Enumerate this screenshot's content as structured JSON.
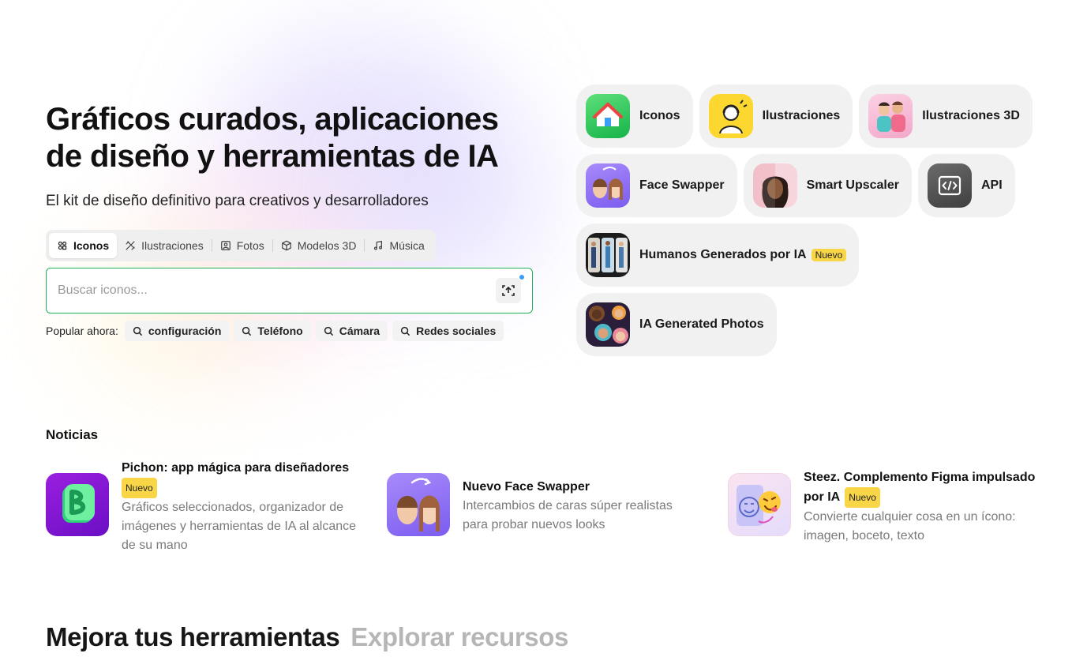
{
  "hero": {
    "title_line1": "Gráficos curados, aplicaciones",
    "title_line2": "de diseño y herramientas de IA",
    "subtitle": "El kit de diseño definitivo para creativos y desarrolladores"
  },
  "type_tabs": [
    {
      "label": "Iconos",
      "icon": "icons-icon",
      "active": true
    },
    {
      "label": "Ilustraciones",
      "icon": "illustrations-icon",
      "active": false
    },
    {
      "label": "Fotos",
      "icon": "photo-icon",
      "active": false
    },
    {
      "label": "Modelos 3D",
      "icon": "cube-icon",
      "active": false
    },
    {
      "label": "Música",
      "icon": "music-icon",
      "active": false
    }
  ],
  "search": {
    "placeholder": "Buscar iconos...",
    "value": "",
    "focus_color": "#20b15a"
  },
  "popular": {
    "label": "Popular ahora:",
    "items": [
      "configuración",
      "Teléfono",
      "Cámara",
      "Redes sociales"
    ]
  },
  "apps": [
    {
      "label": "Iconos",
      "icon": "house-app-icon"
    },
    {
      "label": "Ilustraciones",
      "icon": "illustration-app-icon"
    },
    {
      "label": "Ilustraciones 3D",
      "icon": "3d-illustration-app-icon"
    },
    {
      "label": "Face Swapper",
      "icon": "face-swapper-app-icon"
    },
    {
      "label": "Smart Upscaler",
      "icon": "upscaler-app-icon"
    },
    {
      "label": "API",
      "icon": "api-app-icon"
    },
    {
      "label": "Humanos Generados por IA",
      "icon": "humans-app-icon",
      "badge": "Nuevo"
    },
    {
      "label": "IA Generated Photos",
      "icon": "photos-app-icon"
    }
  ],
  "news": {
    "title": "Noticias",
    "items": [
      {
        "title": "Pichon: app mágica para diseñadores",
        "badge": "Nuevo",
        "description": "Gráficos seleccionados, organizador de imágenes y herramientas de IA al alcance de su mano",
        "icon": "pichon-app-icon"
      },
      {
        "title": "Nuevo Face Swapper",
        "badge": "",
        "description": "Intercambios de caras súper realistas para probar nuevos looks",
        "icon": "face-swapper-news-icon"
      },
      {
        "title": "Steez. Complemento Figma impulsado por IA",
        "badge": "Nuevo",
        "description": "Convierte cualquier cosa en un ícono: imagen, boceto, texto",
        "icon": "steez-plugin-icon"
      }
    ]
  },
  "bottom": {
    "title": "Mejora tus herramientas",
    "secondary": "Explorar recursos"
  },
  "colors": {
    "badge": "#f9d648",
    "card_bg": "#f1f1f1",
    "accent_green": "#20b15a"
  }
}
